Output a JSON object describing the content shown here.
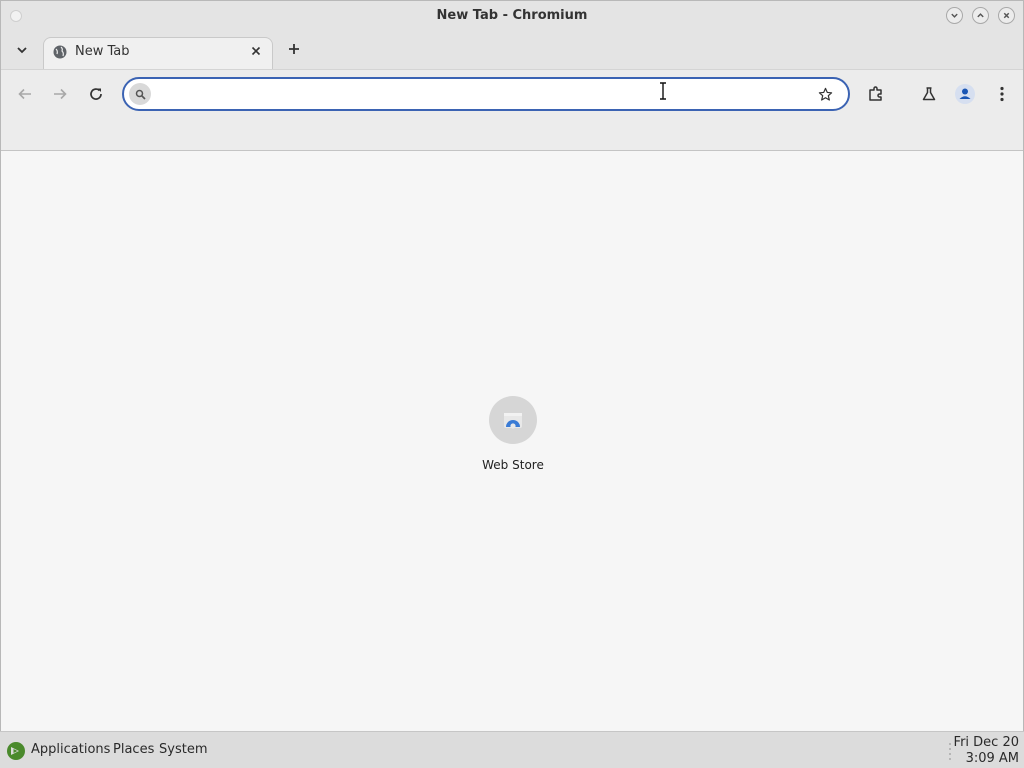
{
  "window": {
    "title": "New Tab - Chromium"
  },
  "tabs": [
    {
      "title": "New Tab",
      "favicon": "globe-icon",
      "active": true
    }
  ],
  "toolbar": {
    "omnibox": {
      "value": "",
      "placeholder": ""
    },
    "icons": [
      "back-arrow-icon",
      "forward-arrow-icon",
      "reload-icon",
      "bookmark-star-icon",
      "extensions-icon",
      "labs-flask-icon",
      "profile-icon",
      "menu-dots-icon"
    ]
  },
  "content": {
    "shortcuts": [
      {
        "label": "Web Store",
        "icon": "web-store-icon"
      }
    ]
  },
  "taskbar": {
    "menus": [
      "Applications",
      "Places",
      "System"
    ],
    "clock": {
      "date": "Fri Dec 20",
      "time": "3:09 AM"
    }
  },
  "colors": {
    "accent": "#3b63b3",
    "profile": "#1a56b4",
    "taskbar_logo": "#4a8a2c"
  }
}
